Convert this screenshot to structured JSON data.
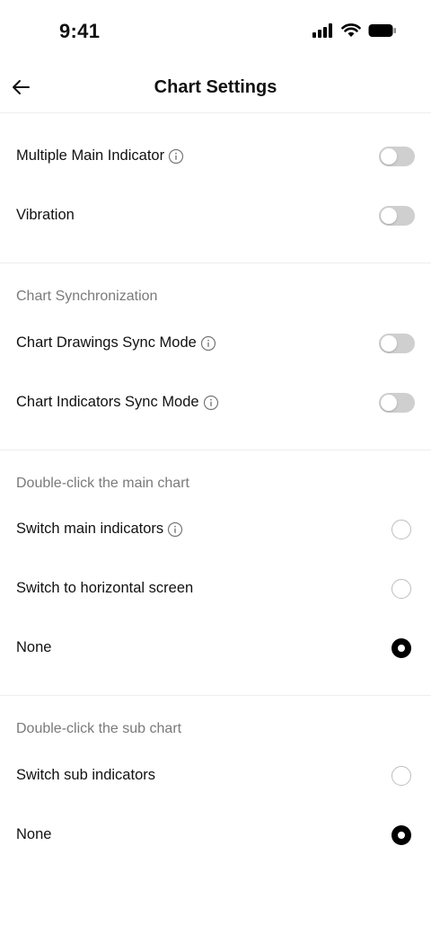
{
  "status_bar": {
    "time": "9:41",
    "icons": [
      "cellular-signal-icon",
      "wifi-icon",
      "battery-icon"
    ]
  },
  "header": {
    "title": "Chart Settings",
    "back_icon": "arrow-left-icon"
  },
  "general": {
    "multiple_main_indicator": {
      "label": "Multiple Main Indicator",
      "enabled": false,
      "has_info": true
    },
    "vibration": {
      "label": "Vibration",
      "enabled": false,
      "has_info": false
    }
  },
  "sync": {
    "title": "Chart Synchronization",
    "drawings": {
      "label": "Chart Drawings Sync Mode",
      "enabled": false,
      "has_info": true
    },
    "indicators": {
      "label": "Chart Indicators Sync Mode",
      "enabled": false,
      "has_info": true
    }
  },
  "main_chart": {
    "title": "Double-click the main chart",
    "options": [
      {
        "label": "Switch main indicators",
        "selected": false,
        "has_info": true
      },
      {
        "label": "Switch to horizontal screen",
        "selected": false,
        "has_info": false
      },
      {
        "label": "None",
        "selected": true,
        "has_info": false
      }
    ]
  },
  "sub_chart": {
    "title": "Double-click the sub chart",
    "options": [
      {
        "label": "Switch sub indicators",
        "selected": false,
        "has_info": false
      },
      {
        "label": "None",
        "selected": true,
        "has_info": false
      }
    ]
  },
  "colors": {
    "toggle_off": "#cfcfcf",
    "radio_selected": "#000000",
    "section_title": "#7a7a7a",
    "divider": "#eeeeee"
  }
}
